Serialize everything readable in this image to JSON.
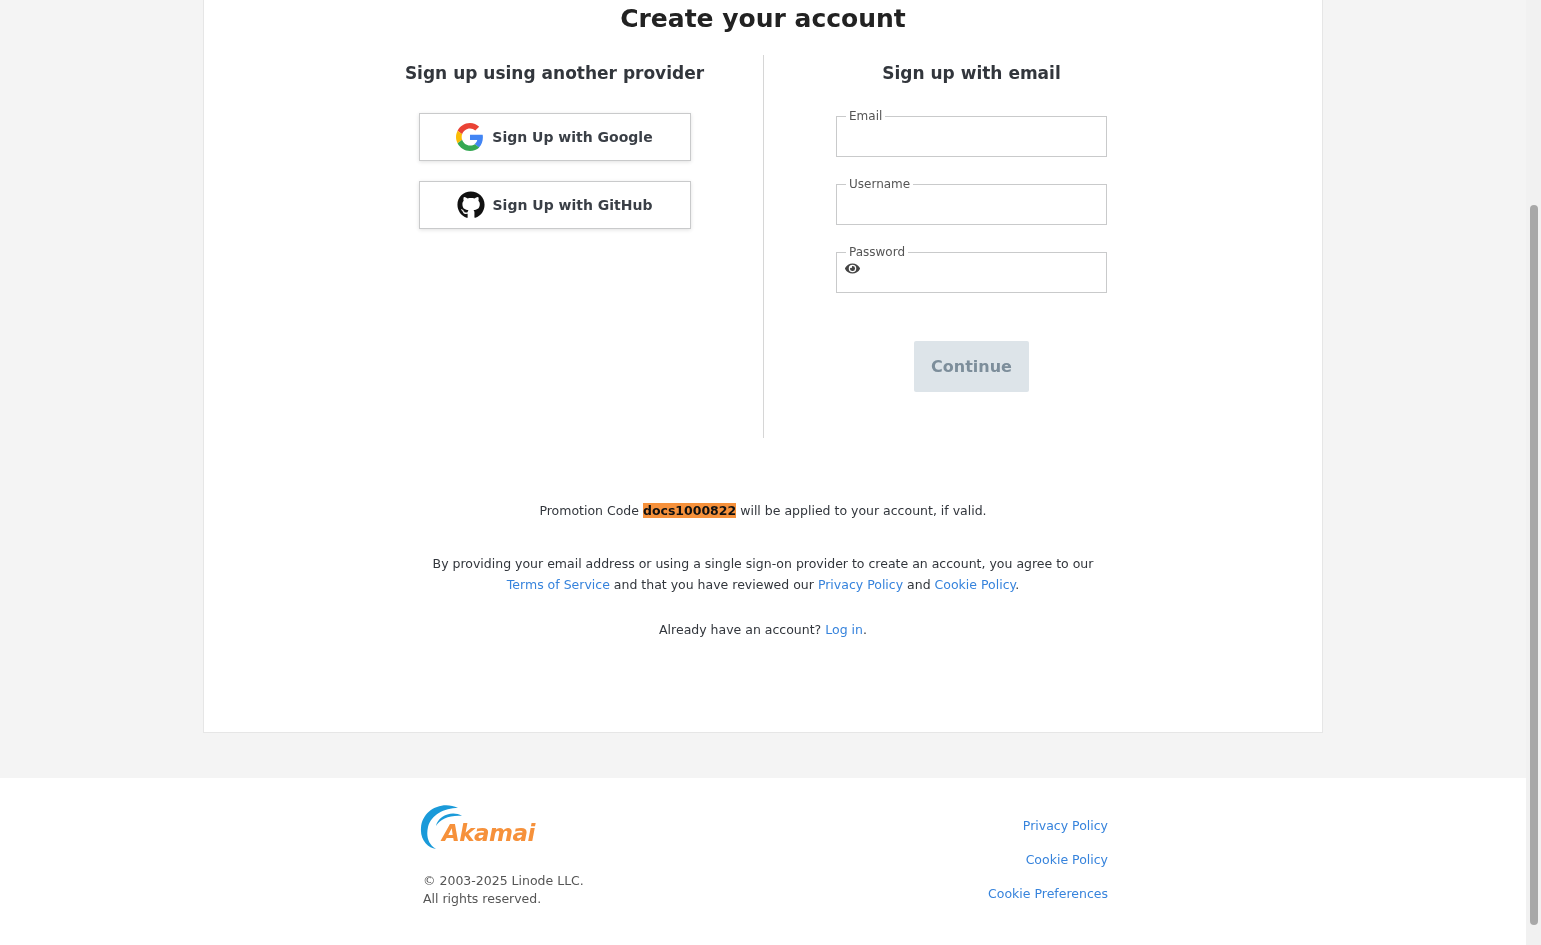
{
  "title": "Create your account",
  "providers": {
    "heading": "Sign up using another provider",
    "buttons": [
      {
        "kind": "google",
        "label": "Sign Up with Google"
      },
      {
        "kind": "github",
        "label": "Sign Up with GitHub"
      }
    ]
  },
  "email_signup": {
    "heading": "Sign up with email",
    "fields": [
      {
        "kind": "text",
        "label": "Email"
      },
      {
        "kind": "text",
        "label": "Username"
      },
      {
        "kind": "password",
        "label": "Password"
      }
    ],
    "continue_button": {
      "label": "Continue",
      "disabled": true
    }
  },
  "promotion": "Promotion Code **docs1000822** will be applied to your account, if valid.",
  "legal": [
    {
      "kind": "text",
      "text": "By providing your email address or using a single sign-on provider to create an account, you agree to our"
    },
    {
      "kind": "link",
      "text": "Terms of Service"
    },
    {
      "kind": "text",
      "text": "and that you have reviewed our"
    },
    {
      "kind": "link",
      "text": "Privacy Policy"
    },
    {
      "kind": "text",
      "text": "and"
    },
    {
      "kind": "link",
      "text": "Cookie Policy"
    },
    {
      "kind": "text",
      "text": "."
    }
  ],
  "login": [
    {
      "kind": "text",
      "text": "Already have an account?"
    },
    {
      "kind": "link",
      "text": "Log in"
    },
    {
      "kind": "text",
      "text": "."
    }
  ],
  "footer": {
    "logo": "Akamai",
    "copyright": [
      "© 2003-2025 Linode LLC.",
      "All rights reserved."
    ],
    "links": [
      "Privacy Policy",
      "Cookie Policy",
      "Cookie Preferences"
    ]
  }
}
